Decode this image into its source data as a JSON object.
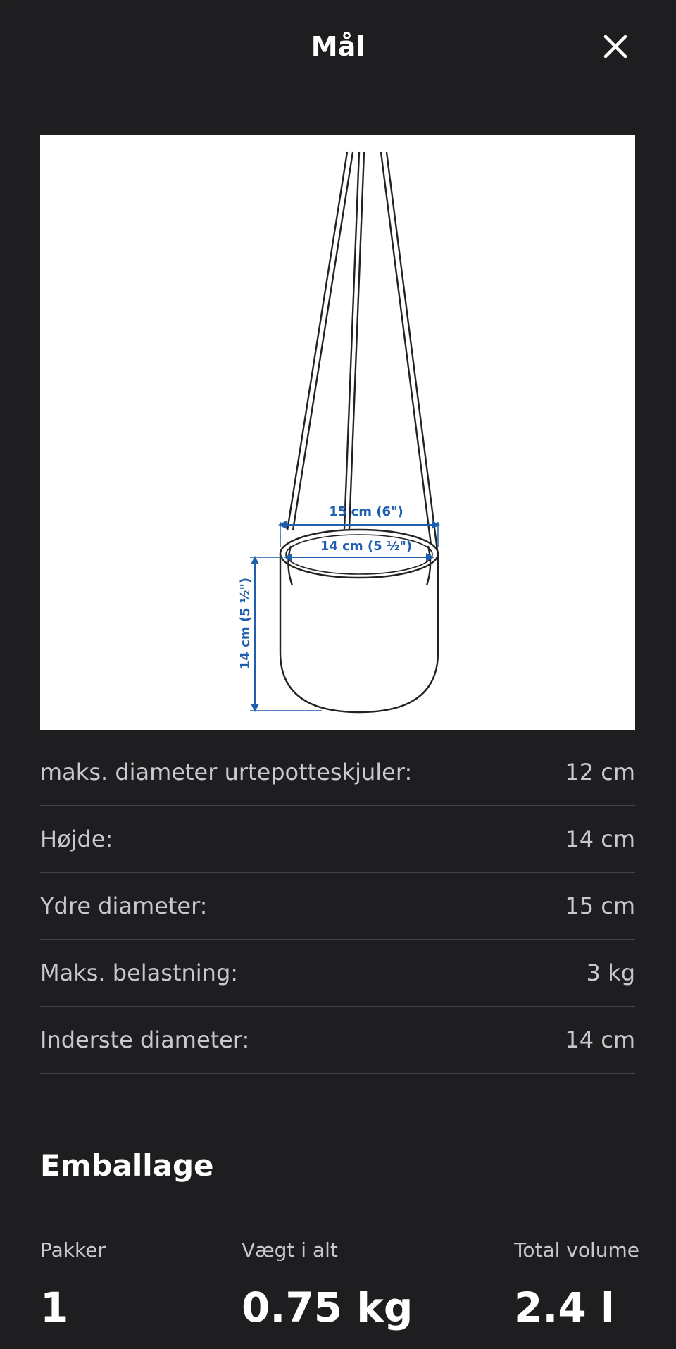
{
  "header": {
    "title": "Mål",
    "close_icon": "close-icon"
  },
  "figure": {
    "outer_diameter_label": "15 cm (6\")",
    "inner_diameter_label": "14 cm (5 ½\")",
    "height_label": "14 cm (5 ½\")",
    "dimension_color": "#1f5fae"
  },
  "dimensions": [
    {
      "label": "maks. diameter urtepotteskjuler:",
      "value": "12 cm"
    },
    {
      "label": "Højde:",
      "value": "14 cm"
    },
    {
      "label": "Ydre diameter:",
      "value": "15 cm"
    },
    {
      "label": "Maks. belastning:",
      "value": "3 kg"
    },
    {
      "label": "Inderste diameter:",
      "value": "14 cm"
    }
  ],
  "packaging": {
    "title": "Emballage",
    "packages_label": "Pakker",
    "packages_value": "1",
    "weight_label": "Vægt i alt",
    "weight_value": "0.75 kg",
    "volume_label": "Total volume",
    "volume_value": "2.4 l"
  }
}
